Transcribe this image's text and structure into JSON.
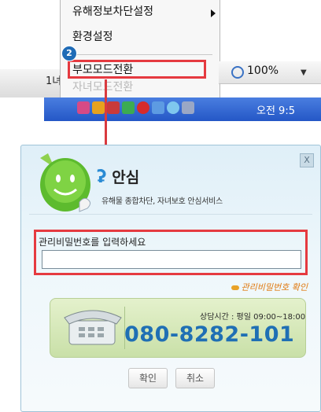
{
  "context_menu": {
    "items": [
      {
        "label": "유해정보차단설정",
        "has_submenu": true,
        "enabled": true
      },
      {
        "label": "환경설정",
        "enabled": true
      },
      {
        "label": "부모모드전환",
        "enabled": true,
        "highlighted": true
      },
      {
        "label": "자녀모드전환",
        "enabled": false
      }
    ],
    "step_badge": "2"
  },
  "browser": {
    "left_fragment": "1녀",
    "help_fragment": "?",
    "zoom_level": "100%"
  },
  "taskbar": {
    "clock_text": "오전 9:5"
  },
  "dialog": {
    "brand_name": "안심",
    "brand_subtitle": "유해물 종합차단, 자녀보호 안심서비스",
    "password_label": "관리비밀번호를 입력하세요",
    "password_value": "",
    "password_confirm_link": "관리비밀번호 확인",
    "support_hours": "상담시간 : 평일 09:00~18:00",
    "phone_number": "080-8282-101",
    "ok_label": "확인",
    "cancel_label": "취소",
    "close_label": "X"
  },
  "colors": {
    "highlight_red": "#e53a40",
    "phone_blue": "#1f6fb4",
    "link_orange": "#e07a11",
    "taskbar_blue": "#2457c6"
  }
}
